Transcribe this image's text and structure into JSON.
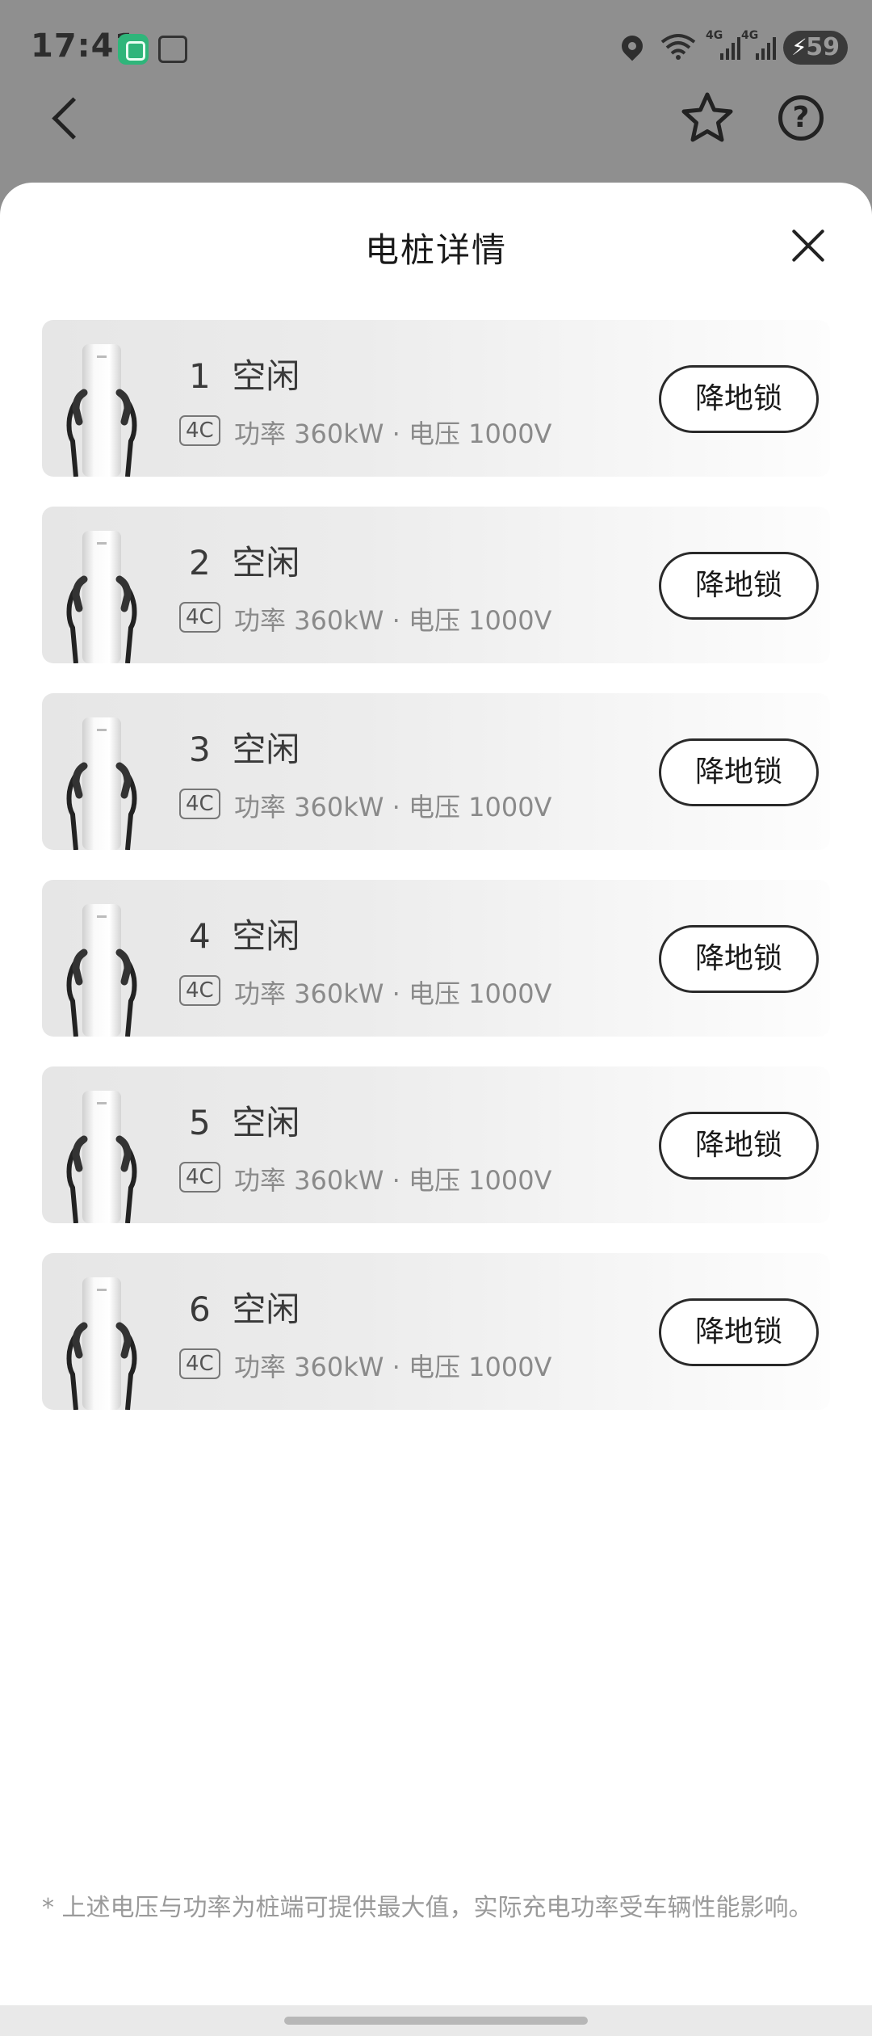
{
  "status_bar": {
    "time": "17:41",
    "network_1": "4G",
    "network_2": "4G",
    "battery": "59",
    "icons": [
      "mi-home-icon",
      "screenshot-icon",
      "location-icon",
      "wifi-icon",
      "signal-icon",
      "battery-charging-icon"
    ]
  },
  "nav": {
    "icons": [
      "back-arrow-icon",
      "star-icon",
      "help-icon"
    ],
    "help_glyph": "?"
  },
  "sheet": {
    "title": "电桩详情",
    "close_icon": "close-icon"
  },
  "piles": [
    {
      "title": "1  空闲",
      "badge": "4C",
      "spec": "功率 360kW · 电压 1000V",
      "button": "降地锁"
    },
    {
      "title": "2  空闲",
      "badge": "4C",
      "spec": "功率 360kW · 电压 1000V",
      "button": "降地锁"
    },
    {
      "title": "3  空闲",
      "badge": "4C",
      "spec": "功率 360kW · 电压 1000V",
      "button": "降地锁"
    },
    {
      "title": "4  空闲",
      "badge": "4C",
      "spec": "功率 360kW · 电压 1000V",
      "button": "降地锁"
    },
    {
      "title": "5  空闲",
      "badge": "4C",
      "spec": "功率 360kW · 电压 1000V",
      "button": "降地锁"
    },
    {
      "title": "6  空闲",
      "badge": "4C",
      "spec": "功率 360kW · 电压 1000V",
      "button": "降地锁"
    }
  ],
  "disclaimer": "* 上述电压与功率为桩端可提供最大值，实际充电功率受车辆性能影响。",
  "colors": {
    "overlay": "#8f8f8f",
    "sheet": "#ffffff",
    "text_primary": "#1a1a1a",
    "text_secondary": "#8a8a8a",
    "status_app_green": "#2fb57a"
  }
}
